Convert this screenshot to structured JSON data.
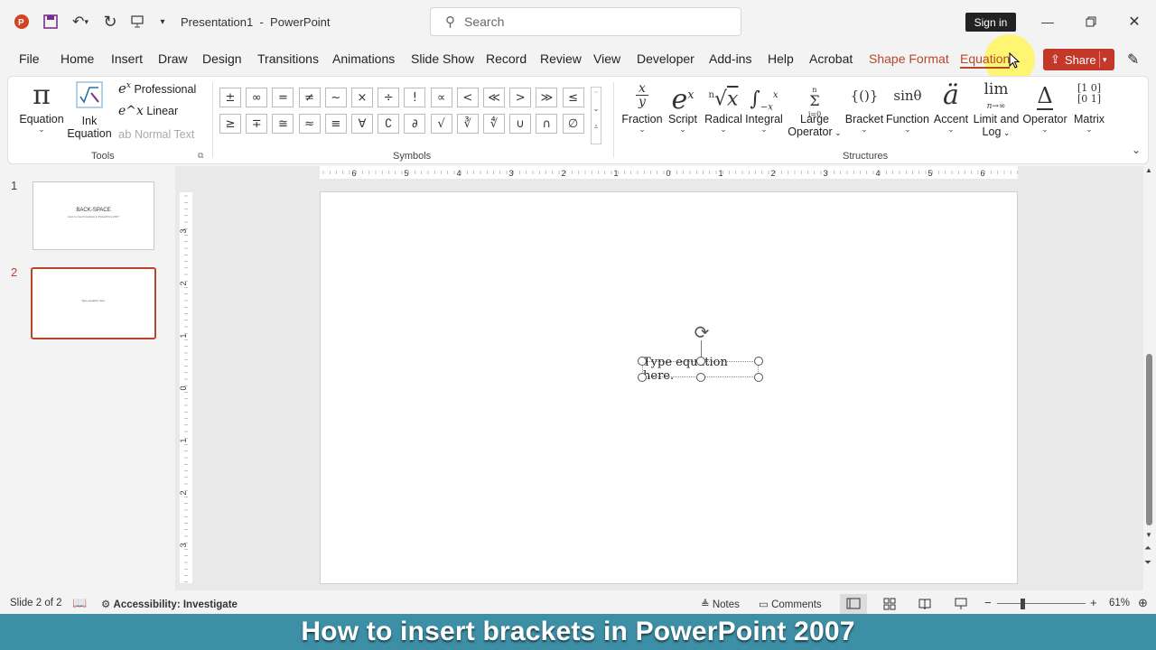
{
  "titlebar": {
    "doc_title": "Presentation1",
    "separator": "-",
    "app_name": "PowerPoint",
    "search_placeholder": "Search",
    "signin_label": "Sign in"
  },
  "tabs": [
    {
      "label": "File"
    },
    {
      "label": "Home"
    },
    {
      "label": "Insert"
    },
    {
      "label": "Draw"
    },
    {
      "label": "Design"
    },
    {
      "label": "Transitions"
    },
    {
      "label": "Animations"
    },
    {
      "label": "Slide Show"
    },
    {
      "label": "Record"
    },
    {
      "label": "Review"
    },
    {
      "label": "View"
    },
    {
      "label": "Developer"
    },
    {
      "label": "Add-ins"
    },
    {
      "label": "Help"
    },
    {
      "label": "Acrobat"
    },
    {
      "label": "Shape Format"
    },
    {
      "label": "Equation"
    }
  ],
  "share_label": "Share",
  "ribbon": {
    "tools": {
      "equation_label": "Equation",
      "ink_label_1": "Ink",
      "ink_label_2": "Equation",
      "professional_label": "Professional",
      "linear_label": "Linear",
      "normal_text_label": "Normal Text",
      "group_label": "Tools"
    },
    "symbols": {
      "row1": [
        "±",
        "∞",
        "=",
        "≠",
        "~",
        "×",
        "÷",
        "!",
        "∝",
        "<",
        "≪",
        ">",
        "≫",
        "≤"
      ],
      "row2": [
        "≥",
        "∓",
        "≅",
        "≈",
        "≡",
        "∀",
        "∁",
        "∂",
        "√",
        "∛",
        "∜",
        "∪",
        "∩",
        "∅"
      ],
      "group_label": "Symbols"
    },
    "structures": {
      "items": [
        {
          "label": "Fraction",
          "label2": ""
        },
        {
          "label": "Script",
          "label2": ""
        },
        {
          "label": "Radical",
          "label2": ""
        },
        {
          "label": "Integral",
          "label2": ""
        },
        {
          "label": "Large",
          "label2": "Operator"
        },
        {
          "label": "Bracket",
          "label2": ""
        },
        {
          "label": "Function",
          "label2": ""
        },
        {
          "label": "Accent",
          "label2": ""
        },
        {
          "label": "Limit and",
          "label2": "Log"
        },
        {
          "label": "Operator",
          "label2": ""
        },
        {
          "label": "Matrix",
          "label2": ""
        }
      ],
      "group_label": "Structures"
    }
  },
  "thumbnails": [
    {
      "number": "1",
      "title": "BACK-SPACE",
      "subtitle": "How to insert brackets in PowerPoint 2007"
    },
    {
      "number": "2",
      "title": "Type equation here."
    }
  ],
  "ruler": {
    "h_labels": [
      "6",
      "5",
      "4",
      "3",
      "2",
      "1",
      "0",
      "1",
      "2",
      "3",
      "4",
      "5",
      "6"
    ],
    "v_labels": [
      "3",
      "2",
      "1",
      "0",
      "1",
      "2",
      "3"
    ]
  },
  "slide": {
    "equation_placeholder": "Type equation here."
  },
  "status": {
    "slide_info": "Slide 2 of 2",
    "accessibility": "Accessibility: Investigate",
    "notes_label": "Notes",
    "comments_label": "Comments",
    "zoom_minus": "−",
    "zoom_plus": "+",
    "zoom_level": "61%"
  },
  "banner_text": "How to insert brackets in PowerPoint 2007",
  "colors": {
    "accent": "#b7472a",
    "share_bg": "#c4382a",
    "banner_bg": "#3d8fa6"
  }
}
